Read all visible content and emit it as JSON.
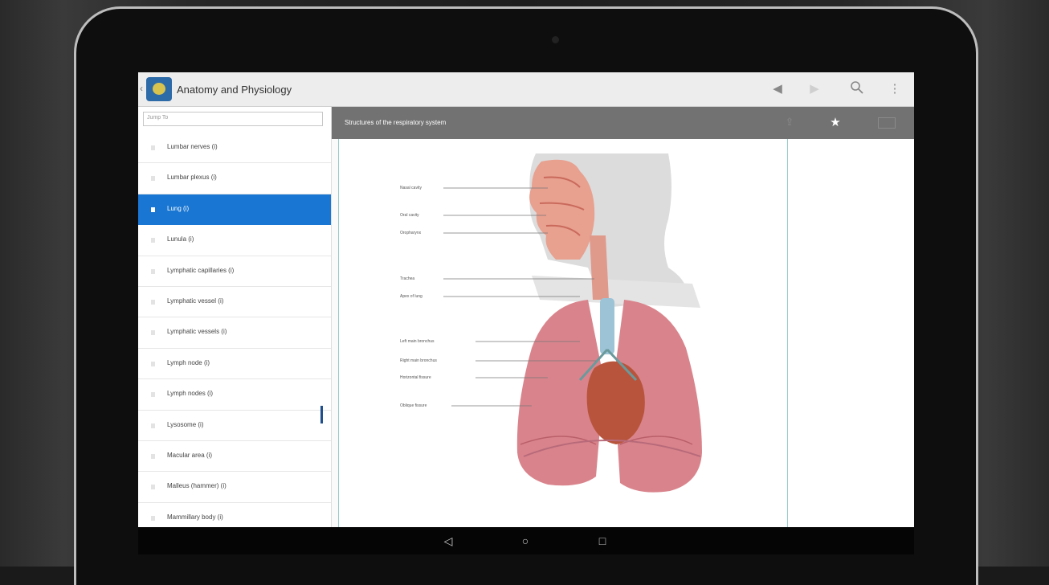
{
  "app": {
    "title": "Anatomy and Physiology",
    "back_glyph": "‹",
    "icon_name": "app-logo-icon"
  },
  "actionbar": {
    "nav_back_icon": "◀",
    "nav_forward_icon": "▶",
    "search_icon": "⚲",
    "overflow_icon": "⋮"
  },
  "sidebar": {
    "jump_placeholder": "Jump To",
    "items": [
      {
        "label": "Lumbar nerves (i)",
        "active": false
      },
      {
        "label": "Lumbar plexus (i)",
        "active": false
      },
      {
        "label": "Lung (i)",
        "active": true
      },
      {
        "label": "Lunula (i)",
        "active": false
      },
      {
        "label": "Lymphatic capillaries (i)",
        "active": false
      },
      {
        "label": "Lymphatic vessel (i)",
        "active": false
      },
      {
        "label": "Lymphatic vessels (i)",
        "active": false
      },
      {
        "label": "Lymph node (i)",
        "active": false
      },
      {
        "label": "Lymph nodes (i)",
        "active": false
      },
      {
        "label": "Lysosome (i)",
        "active": false
      },
      {
        "label": "Macular area (i)",
        "active": false
      },
      {
        "label": "Malleus (hammer) (i)",
        "active": false
      },
      {
        "label": "Mammillary body (i)",
        "active": false
      }
    ]
  },
  "content": {
    "title": "Structures of the respiratory system",
    "share_icon": "⇪",
    "star_icon": "★",
    "figure_labels": [
      "Nasal cavity",
      "Oral cavity",
      "Oropharynx",
      "Trachea",
      "Apex of lung",
      "Left main bronchus",
      "Right main bronchus",
      "Horizontal fissure",
      "Oblique fissure"
    ]
  },
  "system_nav": {
    "back_icon": "◁",
    "home_icon": "○",
    "recents_icon": "□"
  },
  "colors": {
    "selection": "#1976d2",
    "content_header": "#727272",
    "lung": "#d9848c",
    "airway": "#e8a08f",
    "trachea": "#9cc3d6"
  }
}
